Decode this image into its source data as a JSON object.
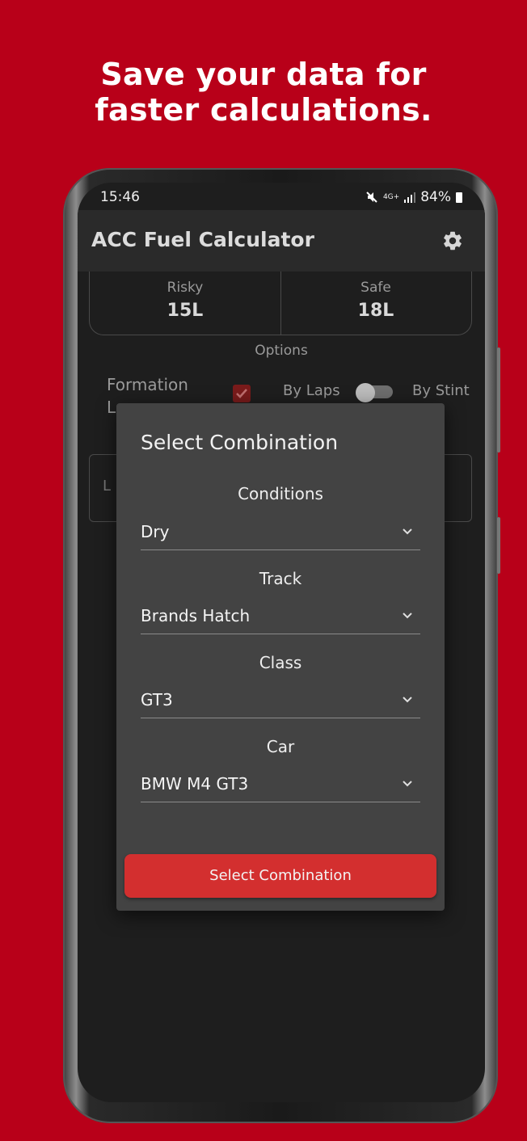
{
  "headline": {
    "line1": "Save your data for",
    "line2": "faster calculations."
  },
  "status_bar": {
    "time": "15:46",
    "signal_text": "4G+",
    "battery": "84%"
  },
  "app_bar": {
    "title": "ACC Fuel Calculator",
    "settings_icon": "gear-icon"
  },
  "results": {
    "risky_label": "Risky",
    "risky_value": "15L",
    "safe_label": "Safe",
    "safe_value": "18L"
  },
  "options": {
    "title": "Options",
    "formation_line1": "Formation",
    "formation_line2": "L",
    "formation_checked": true,
    "by_laps": "By Laps",
    "by_stint": "By Stint",
    "laps_field_fragment": "L"
  },
  "dialog": {
    "title": "Select Combination",
    "fields": [
      {
        "label": "Conditions",
        "value": "Dry"
      },
      {
        "label": "Track",
        "value": "Brands Hatch"
      },
      {
        "label": "Class",
        "value": "GT3"
      },
      {
        "label": "Car",
        "value": "BMW M4 GT3"
      }
    ],
    "button_label": "Select Combination"
  },
  "colors": {
    "background": "#b80019",
    "accent_button": "#d32f2f",
    "dialog_bg": "#434343",
    "screen_bg": "#1e1e1e"
  }
}
